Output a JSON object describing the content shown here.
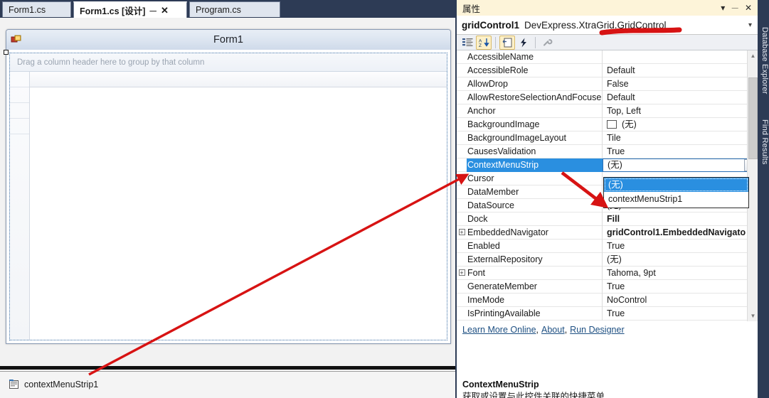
{
  "editor_tabs": [
    {
      "label": "Form1.cs",
      "active": false,
      "closable": false
    },
    {
      "label": "Form1.cs [设计]",
      "active": true,
      "closable": true,
      "pin_icon": "pin-icon",
      "close_icon": "close-icon"
    },
    {
      "label": "Program.cs",
      "active": false,
      "closable": false
    }
  ],
  "designer": {
    "form_title": "Form1",
    "form_icon": "form-designer-icon",
    "grid": {
      "group_panel_text": "Drag a column header here to group by that column"
    },
    "tray": {
      "item_label": "contextMenuStrip1",
      "item_icon": "context-menu-strip-icon"
    }
  },
  "properties_window": {
    "title": "属性",
    "titlebar_buttons": [
      {
        "name": "window-menu-icon",
        "glyph": "▾"
      },
      {
        "name": "pin-icon",
        "glyph": "┤"
      },
      {
        "name": "close-icon",
        "glyph": "✕"
      }
    ],
    "object_selector": {
      "object_name": "gridControl1",
      "object_type": "DevExpress.XtraGrid.GridControl",
      "dropdown_icon": "chevron-down-icon"
    },
    "toolbar": [
      {
        "name": "categorized-view-button",
        "title": "Categorized",
        "active": false
      },
      {
        "name": "alphabetical-sort-button",
        "title": "Alphabetical",
        "active": true
      },
      {
        "name": "properties-page-button",
        "title": "Properties",
        "active": true
      },
      {
        "name": "events-button",
        "title": "Events",
        "active": false
      },
      {
        "name": "property-pages-button",
        "title": "Property Pages",
        "active": false
      }
    ],
    "rows": [
      {
        "expander": "",
        "name": "AccessibleName",
        "value": "",
        "bold": false
      },
      {
        "expander": "",
        "name": "AccessibleRole",
        "value": "Default",
        "bold": false
      },
      {
        "expander": "",
        "name": "AllowDrop",
        "value": "False",
        "bold": false
      },
      {
        "expander": "",
        "name": "AllowRestoreSelectionAndFocuse",
        "value": "Default",
        "bold": false
      },
      {
        "expander": "",
        "name": "Anchor",
        "value": "Top, Left",
        "bold": false
      },
      {
        "expander": "",
        "name": "BackgroundImage",
        "value": "(无)",
        "bold": false,
        "swatch": true
      },
      {
        "expander": "",
        "name": "BackgroundImageLayout",
        "value": "Tile",
        "bold": false
      },
      {
        "expander": "",
        "name": "CausesValidation",
        "value": "True",
        "bold": false
      },
      {
        "expander": "",
        "name": "ContextMenuStrip",
        "value": "(无)",
        "bold": false,
        "selected": true,
        "editing": true,
        "editor_icon": "chevron-down-icon"
      },
      {
        "expander": "",
        "name": "Cursor",
        "value": "",
        "bold": false
      },
      {
        "expander": "",
        "name": "DataMember",
        "value": "",
        "bold": false
      },
      {
        "expander": "",
        "name": "DataSource",
        "value": "(无)",
        "bold": false
      },
      {
        "expander": "",
        "name": "Dock",
        "value": "Fill",
        "bold": true
      },
      {
        "expander": "+",
        "name": "EmbeddedNavigator",
        "value": "gridControl1.EmbeddedNavigato",
        "bold": true
      },
      {
        "expander": "",
        "name": "Enabled",
        "value": "True",
        "bold": false
      },
      {
        "expander": "",
        "name": "ExternalRepository",
        "value": "(无)",
        "bold": false
      },
      {
        "expander": "+",
        "name": "Font",
        "value": "Tahoma, 9pt",
        "bold": false
      },
      {
        "expander": "",
        "name": "GenerateMember",
        "value": "True",
        "bold": false
      },
      {
        "expander": "",
        "name": "ImeMode",
        "value": "NoControl",
        "bold": false
      },
      {
        "expander": "",
        "name": "IsPrintingAvailable",
        "value": "True",
        "bold": false
      }
    ],
    "dropdown_open": {
      "items": [
        {
          "label": "(无)",
          "selected": true
        },
        {
          "label": "contextMenuStrip1",
          "selected": false
        }
      ]
    },
    "links": [
      {
        "label": "Learn More Online",
        "name": "learn-more-online-link"
      },
      {
        "label": "About",
        "name": "about-link"
      },
      {
        "label": "Run Designer",
        "name": "run-designer-link"
      }
    ],
    "link_separator": ",",
    "description": {
      "title": "ContextMenuStrip",
      "body": "获取或设置与此控件关联的快捷菜单"
    },
    "scrollbar": {
      "up_icon": "scroll-up-icon",
      "down_icon": "scroll-down-icon",
      "thumb_name": "scroll-thumb"
    }
  },
  "right_dock_tabs": [
    {
      "label": "Database Explorer",
      "name": "vtab-database-explorer"
    },
    {
      "label": "Find Results",
      "name": "vtab-find-results"
    }
  ],
  "annotations": {
    "colors": {
      "red": "#d71313",
      "dark_red": "#c01010"
    },
    "shapes": [
      {
        "name": "long-arrow-to-contextmenustrip-row"
      },
      {
        "name": "short-arrow-to-dropdown-list"
      },
      {
        "name": "underline-on-object-type"
      }
    ]
  }
}
